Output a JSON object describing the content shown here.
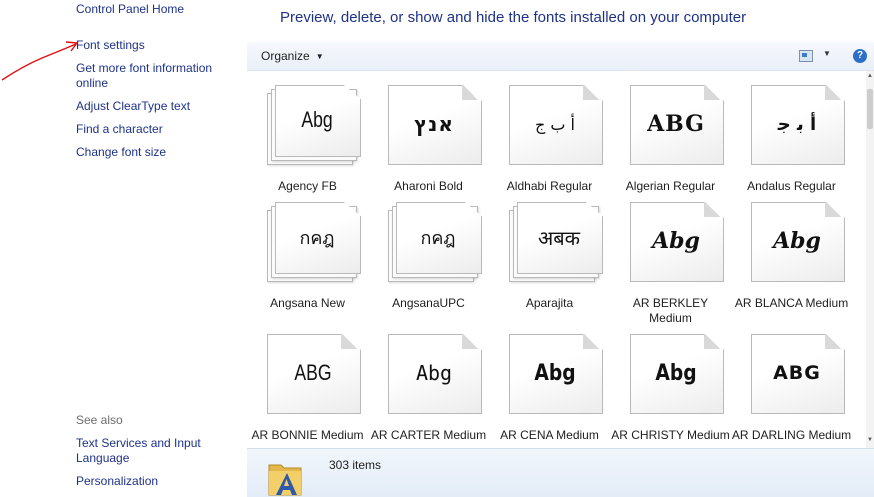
{
  "nav": {
    "control_panel_home": "Control Panel Home",
    "links": [
      {
        "label": "Font settings"
      },
      {
        "label": "Get more font information online"
      },
      {
        "label": "Adjust ClearType text"
      },
      {
        "label": "Find a character"
      },
      {
        "label": "Change font size"
      }
    ],
    "see_also_title": "See also",
    "see_also_links": [
      {
        "label": "Text Services and Input Language"
      },
      {
        "label": "Personalization"
      }
    ]
  },
  "header": {
    "title": "Preview, delete, or show and hide the fonts installed on your computer"
  },
  "toolbar": {
    "organize_label": "Organize",
    "help_label": "?"
  },
  "fonts": [
    {
      "name": "Agency FB",
      "sample": "Abg"
    },
    {
      "name": "Aharoni Bold",
      "sample": "אנץ"
    },
    {
      "name": "Aldhabi Regular",
      "sample": "ﺃ ﺏ ﺝ"
    },
    {
      "name": "Algerian Regular",
      "sample": "ABG"
    },
    {
      "name": "Andalus Regular",
      "sample": "ﺃ ﺑ ﺟ"
    },
    {
      "name": "Angsana New",
      "sample": "กคฎ"
    },
    {
      "name": "AngsanaUPC",
      "sample": "กคฎ"
    },
    {
      "name": "Aparajita",
      "sample": "अबक"
    },
    {
      "name": "AR BERKLEY Medium",
      "sample": "Abg"
    },
    {
      "name": "AR BLANCA Medium",
      "sample": "Abg"
    },
    {
      "name": "AR BONNIE Medium",
      "sample": "ABG"
    },
    {
      "name": "AR CARTER Medium",
      "sample": "Abg"
    },
    {
      "name": "AR CENA Medium",
      "sample": "Abg"
    },
    {
      "name": "AR CHRISTY Medium",
      "sample": "Abg"
    },
    {
      "name": "AR DARLING Medium",
      "sample": "ABG"
    }
  ],
  "details": {
    "item_count": "303 items"
  },
  "colors": {
    "link": "#1e3287",
    "annotation_arrow": "#e01010",
    "details_pane": "#e3ecf7"
  }
}
